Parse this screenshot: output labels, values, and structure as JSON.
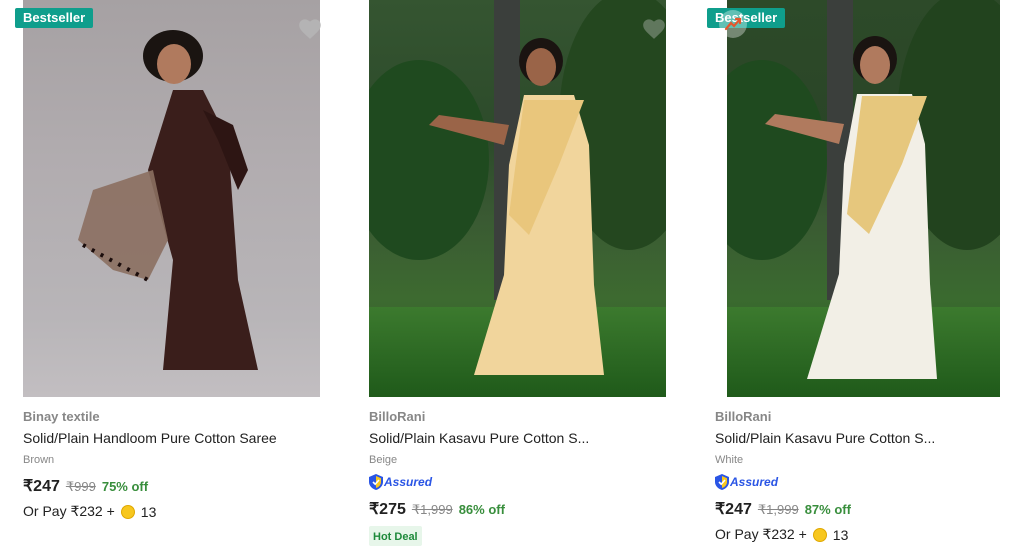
{
  "products": [
    {
      "badge": "Bestseller",
      "brand": "Binay textile",
      "title": "Solid/Plain Handloom Pure Cotton Saree",
      "color": "Brown",
      "price": "₹247",
      "mrp": "₹999",
      "discount": "75% off",
      "or_pay": "Or Pay ₹232 +",
      "coins": "13",
      "wishlist_icon": "heart-icon"
    },
    {
      "brand": "BilloRani",
      "title": "Solid/Plain Kasavu Pure Cotton S...",
      "color": "Beige",
      "assured": "Assured",
      "price": "₹275",
      "mrp": "₹1,999",
      "discount": "86% off",
      "tag": "Hot Deal",
      "wishlist_icon": "heart-icon"
    },
    {
      "badge": "Bestseller",
      "brand": "BilloRani",
      "title": "Solid/Plain Kasavu Pure Cotton S...",
      "color": "White",
      "assured": "Assured",
      "price": "₹247",
      "mrp": "₹1,999",
      "discount": "87% off",
      "or_pay": "Or Pay ₹232 +",
      "coins": "13",
      "trend_icon": "trending-icon"
    }
  ],
  "colors": {
    "badge": "#0f9e8c",
    "discount": "#388e3c",
    "assured": "#2a55e5",
    "muted": "#878787"
  }
}
